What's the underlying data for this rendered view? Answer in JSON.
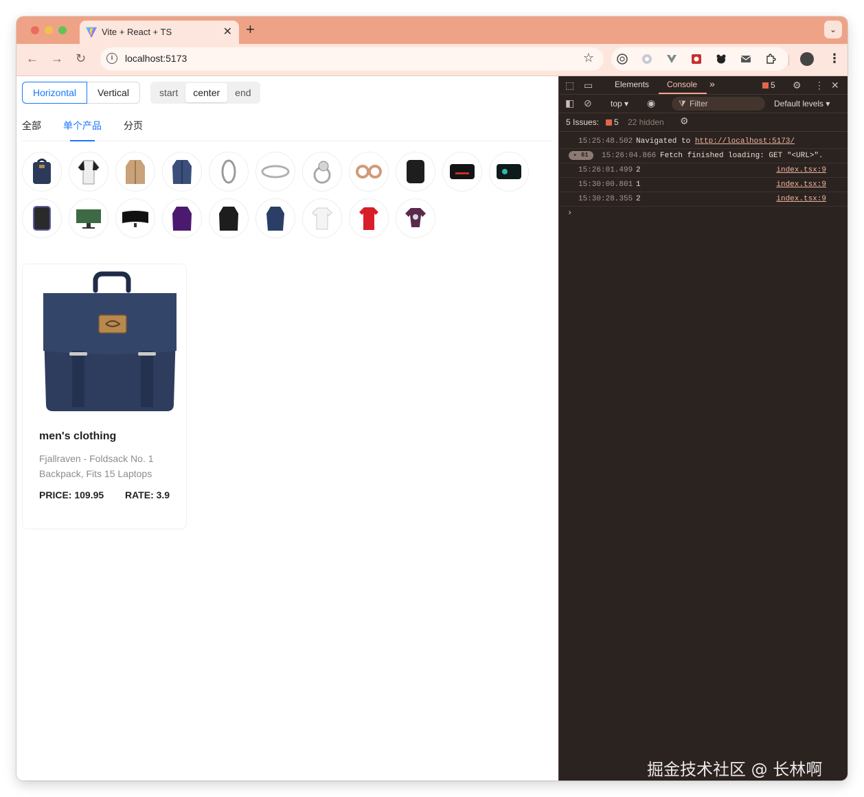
{
  "browser": {
    "tab_title": "Vite + React + TS",
    "tab_close": "✕",
    "new_tab": "+",
    "profile_chevron": "⌄",
    "url": "localhost:5173",
    "accent": "#EEA386"
  },
  "controls": {
    "layout_options": [
      "Horizontal",
      "Vertical"
    ],
    "layout_selected": "Horizontal",
    "align_options": [
      "start",
      "center",
      "end"
    ],
    "align_selected": "center"
  },
  "tabs": {
    "items": [
      "全部",
      "单个产品",
      "分页"
    ],
    "active": "单个产品"
  },
  "product": {
    "category": "men's clothing",
    "title": "Fjallraven - Foldsack No. 1 Backpack, Fits 15 Laptops",
    "price": "PRICE: 109.95",
    "rate": "RATE: 3.9"
  },
  "devtools": {
    "tabs": [
      "Elements",
      "Console"
    ],
    "active_tab": "Console",
    "more": "»",
    "issues_badge": "5",
    "context": "top ▾",
    "filter_placeholder": "Filter",
    "levels": "Default levels ▾",
    "issues_label": "5 Issues:",
    "issues_count": "5",
    "hidden": "22 hidden",
    "logs": [
      {
        "ts": "15:25:48.502",
        "msg_prefix": "Navigated to ",
        "link": "http://localhost:5173/"
      },
      {
        "ts": "15:26:04.866",
        "msg": "Fetch finished loading: GET \"<URL>\".",
        "count": "61"
      },
      {
        "ts": "15:26:01.499",
        "msg": "2",
        "src": "index.tsx:9"
      },
      {
        "ts": "15:30:00.801",
        "msg": "1",
        "src": "index.tsx:9"
      },
      {
        "ts": "15:30:28.355",
        "msg": "2",
        "src": "index.tsx:9"
      }
    ],
    "prompt": "›"
  },
  "watermark": "掘金技术社区 @ 长林啊"
}
